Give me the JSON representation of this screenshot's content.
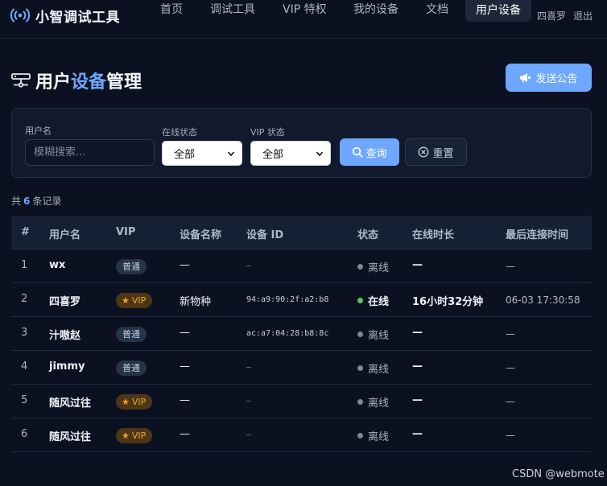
{
  "brand": {
    "name": "小智调试工具",
    "icon": "wifi-signal-icon"
  },
  "nav": {
    "items": [
      {
        "label": "首页"
      },
      {
        "label": "调试工具"
      },
      {
        "label": "VIP 特权"
      },
      {
        "label": "我的设备"
      },
      {
        "label": "文档"
      },
      {
        "label": "用户设备",
        "active": true
      }
    ],
    "user": "四喜罗",
    "logout": "退出"
  },
  "page": {
    "title_prefix": "用户",
    "title_accent": "设备",
    "title_suffix": "管理",
    "title_icon": "server-icon",
    "announce_label": "发送公告",
    "announce_icon": "megaphone-icon"
  },
  "filters": {
    "username_label": "用户名",
    "username_placeholder": "模糊搜索...",
    "username_value": "",
    "online_label": "在线状态",
    "online_value": "全部",
    "vip_label": "VIP 状态",
    "vip_value": "全部",
    "query_label": "查询",
    "reset_label": "重置"
  },
  "records": {
    "prefix": "共",
    "count": "6",
    "suffix": "条记录"
  },
  "table": {
    "headers": [
      "#",
      "用户名",
      "VIP",
      "设备名称",
      "设备 ID",
      "状态",
      "在线时长",
      "最后连接时间"
    ],
    "rows": [
      {
        "idx": "1",
        "user": "wx",
        "vip": "普通",
        "vip_type": "normal",
        "device": "—",
        "device_id": "—",
        "status": "离线",
        "online": false,
        "duration": "—",
        "last": "—"
      },
      {
        "idx": "2",
        "user": "四喜罗",
        "vip": "VIP",
        "vip_type": "vip",
        "device": "新物种",
        "device_id": "94:a9:90:2f:a2:b8",
        "status": "在线",
        "online": true,
        "duration": "16小时32分钟",
        "last": "06-03 17:30:58"
      },
      {
        "idx": "3",
        "user": "汁嗷赵",
        "vip": "普通",
        "vip_type": "normal",
        "device": "—",
        "device_id": "ac:a7:04:28:b8:8c",
        "status": "离线",
        "online": false,
        "duration": "—",
        "last": "—"
      },
      {
        "idx": "4",
        "user": "jimmy",
        "vip": "普通",
        "vip_type": "normal",
        "device": "—",
        "device_id": "—",
        "status": "离线",
        "online": false,
        "duration": "—",
        "last": "—"
      },
      {
        "idx": "5",
        "user": "随风过往",
        "vip": "VIP",
        "vip_type": "vip",
        "device": "—",
        "device_id": "—",
        "status": "离线",
        "online": false,
        "duration": "—",
        "last": "—"
      },
      {
        "idx": "6",
        "user": "随风过往",
        "vip": "VIP",
        "vip_type": "vip",
        "device": "—",
        "device_id": "—",
        "status": "离线",
        "online": false,
        "duration": "—",
        "last": "—"
      }
    ]
  },
  "colors": {
    "background": "#0b1120",
    "accent": "#6ea8fe",
    "online": "#5fc25a",
    "offline": "#7d8799",
    "vip": "#f0a62e"
  },
  "watermark": "CSDN @webmote"
}
